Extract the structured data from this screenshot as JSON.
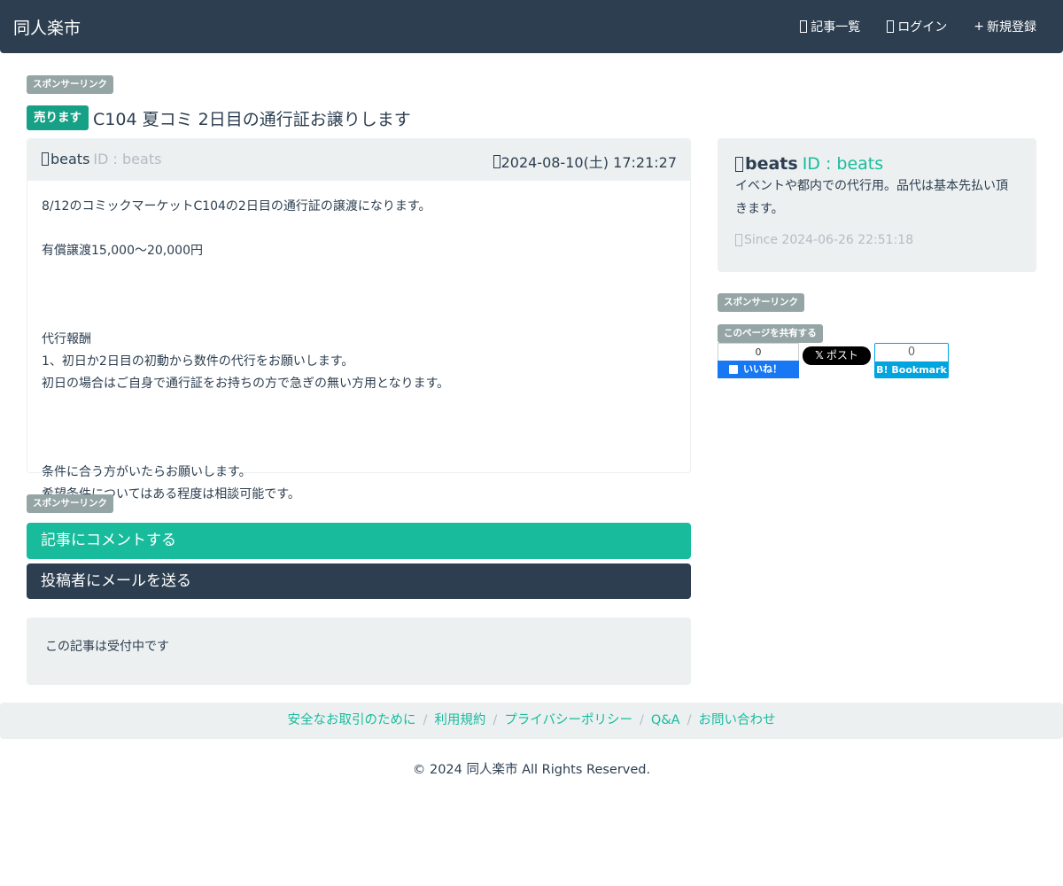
{
  "navbar": {
    "brand": "同人楽市",
    "items": [
      {
        "label": "記事一覧",
        "icon": "list-icon"
      },
      {
        "label": "ログイン",
        "icon": "login-icon"
      },
      {
        "label": "新規登録",
        "icon": "plus-icon",
        "prefix": "+"
      }
    ]
  },
  "sponsor_label": "スポンサーリンク",
  "post": {
    "status_badge": "売ります",
    "title": "C104 夏コミ 2日目の通行証お譲りします",
    "username": "beats",
    "user_id": "ID : beats",
    "date": "2024-08-10(土) 17:21:27",
    "body_lines": [
      "8/12のコミックマーケットC104の2日目の通行証の譲渡になります。",
      "",
      "有償譲渡15,000〜20,000円",
      "",
      "",
      "",
      "代行報酬",
      "1、初日か2日目の初動から数件の代行をお願いします。",
      "初日の場合はご自身で通行証をお持ちの方で急ぎの無い方用となります。",
      "",
      "",
      "",
      "条件に合う方がいたらお願いします。",
      "希望条件についてはある程度は相談可能です。"
    ]
  },
  "profile": {
    "username": "beats",
    "user_id": "ID : beats",
    "description": "イベントや都内での代行用。品代は基本先払い頂きます。",
    "since": "Since 2024-06-26 22:51:18"
  },
  "share": {
    "label": "このページを共有する",
    "fb_count": "0",
    "fb_label": "いいね！",
    "x_label": "ポスト",
    "x_logo": "𝕏",
    "hb_count": "0",
    "hb_label": "B! Bookmark"
  },
  "actions": {
    "comment": "記事にコメントする",
    "mail": "投稿者にメールを送る"
  },
  "status_text": "この記事は受付中です",
  "footer": {
    "links": [
      "安全なお取引のために",
      "利用規約",
      "プライバシーポリシー",
      "Q&A",
      "お問い合わせ"
    ],
    "separator": "/",
    "copyright": "© 2024 同人楽市 All Rights Reserved."
  },
  "colors": {
    "primary": "#2c3e50",
    "success": "#18bc9c",
    "badge_sell": "#16a085",
    "muted": "#b4bcc2",
    "light": "#ecf0f1",
    "sponsor": "#95a5a6"
  }
}
